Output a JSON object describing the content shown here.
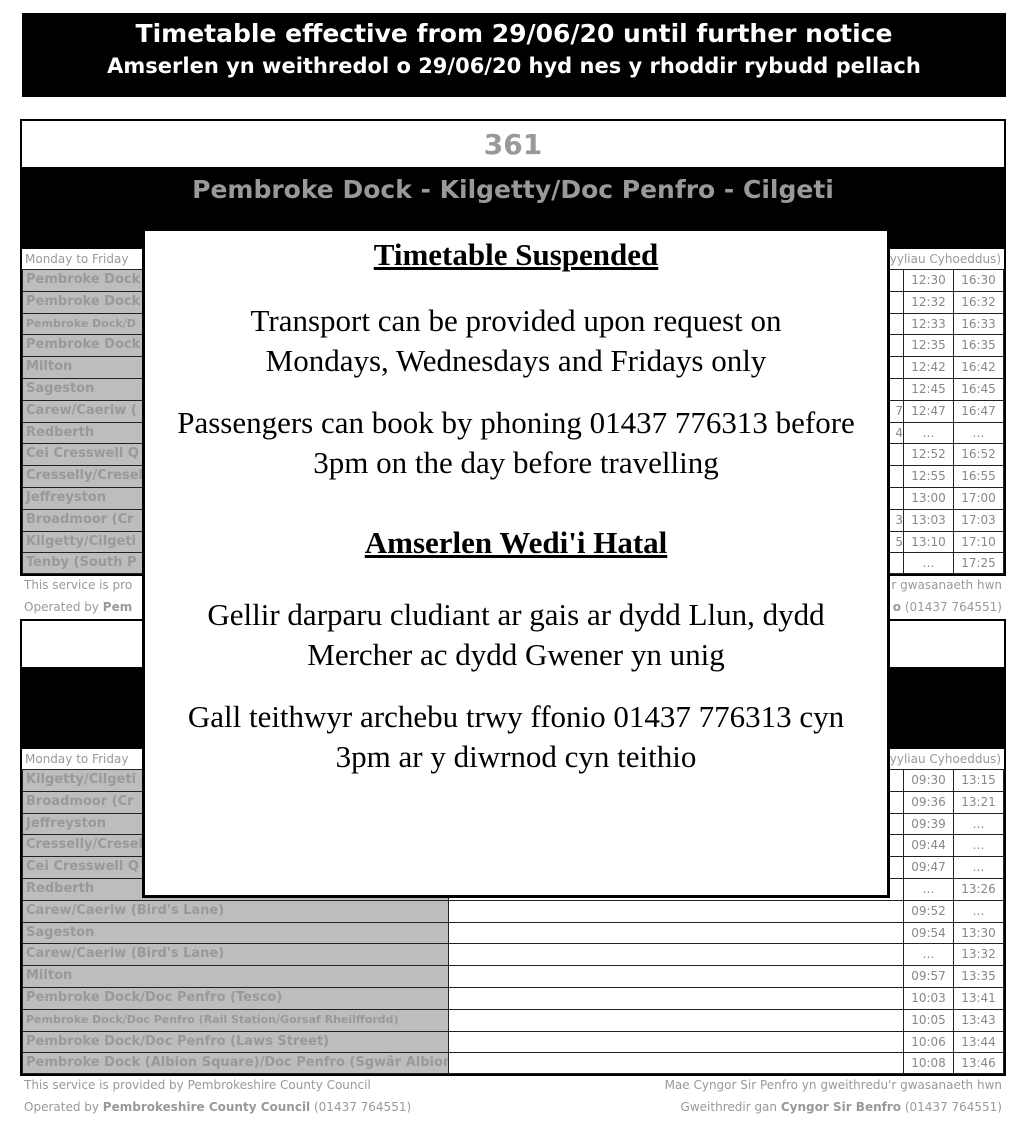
{
  "banner": {
    "line1": "Timetable effective from 29/06/20 until further notice",
    "line2": "Amserlen yn weithredol o 29/06/20 hyd nes y rhoddir rybudd pellach"
  },
  "tables": [
    {
      "number": "361",
      "route": "Pembroke Dock - Kilgetty/Doc Penfro - Cilgeti",
      "days_left": "Monday to Friday",
      "days_right": "yyliau Cyhoeddus)",
      "rows": [
        {
          "stop": "Pembroke Dock",
          "t1": "12:30",
          "t2": "16:30"
        },
        {
          "stop": "Pembroke Dock",
          "t1": "12:32",
          "t2": "16:32"
        },
        {
          "stop": "Pembroke Dock/D",
          "t1": "12:33",
          "t2": "16:33",
          "small": true
        },
        {
          "stop": "Pembroke Dock",
          "t1": "12:35",
          "t2": "16:35"
        },
        {
          "stop": "Milton",
          "t1": "12:42",
          "t2": "16:42"
        },
        {
          "stop": "Sageston",
          "t1": "12:45",
          "t2": "16:45"
        },
        {
          "stop": "Carew/Caeriw (",
          "t0": "7",
          "t1": "12:47",
          "t2": "16:47"
        },
        {
          "stop": "Redberth",
          "t0": "4",
          "t1": "…",
          "t2": "…"
        },
        {
          "stop": "Cei Cresswell Q",
          "t1": "12:52",
          "t2": "16:52"
        },
        {
          "stop": "Cresselly/Cresel",
          "t1": "12:55",
          "t2": "16:55"
        },
        {
          "stop": "Jeffreyston",
          "t1": "13:00",
          "t2": "17:00"
        },
        {
          "stop": "Broadmoor (Cr",
          "t0": "3",
          "t1": "13:03",
          "t2": "17:03"
        },
        {
          "stop": "Kilgetty/Cilgeti (",
          "t0": "5",
          "t1": "13:10",
          "t2": "17:10"
        },
        {
          "stop": "Tenby (South P",
          "t1": "…",
          "t2": "17:25"
        }
      ],
      "footer_left_1": "This service is pro",
      "footer_left_2_pre": "Operated by ",
      "footer_left_2_bold": "Pem",
      "footer_right_1": "r gwasanaeth hwn",
      "footer_right_2_bold": "o",
      "footer_right_2_post": " (01437 764551)"
    },
    {
      "number": "",
      "route": "",
      "days_left": "Monday to Friday",
      "days_right": "yyliau Cyhoeddus)",
      "rows": [
        {
          "stop": "Kilgetty/Cilgeti (",
          "t1": "09:30",
          "t2": "13:15"
        },
        {
          "stop": "Broadmoor (Cr",
          "t1": "09:36",
          "t2": "13:21"
        },
        {
          "stop": "Jeffreyston",
          "t1": "09:39",
          "t2": "…"
        },
        {
          "stop": "Cresselly/Cresel",
          "t1": "09:44",
          "t2": "…"
        },
        {
          "stop": "Cei Cresswell Q",
          "t1": "09:47",
          "t2": "…"
        },
        {
          "stop": "Redberth",
          "t1": "…",
          "t2": "13:26"
        },
        {
          "stop": "Carew/Caeriw (Bird's Lane)",
          "t1": "09:52",
          "t2": "…"
        },
        {
          "stop": "Sageston",
          "t1": "09:54",
          "t2": "13:30"
        },
        {
          "stop": "Carew/Caeriw (Bird's Lane)",
          "t1": "…",
          "t2": "13:32"
        },
        {
          "stop": "Milton",
          "t1": "09:57",
          "t2": "13:35"
        },
        {
          "stop": "Pembroke Dock/Doc Penfro (Tesco)",
          "t1": "10:03",
          "t2": "13:41"
        },
        {
          "stop": "Pembroke Dock/Doc Penfro (Rail Station/Gorsaf Rheilffordd)",
          "t1": "10:05",
          "t2": "13:43",
          "small": true
        },
        {
          "stop": "Pembroke Dock/Doc Penfro (Laws Street)",
          "t1": "10:06",
          "t2": "13:44"
        },
        {
          "stop": "Pembroke Dock (Albion Square)/Doc Penfro (Sgwâr Albion)",
          "t1": "10:08",
          "t2": "13:46"
        }
      ],
      "footer_left_1": "This service is provided by Pembrokeshire County Council",
      "footer_left_2_pre": "Operated by ",
      "footer_left_2_bold": "Pembrokeshire County Council",
      "footer_left_2_post": " (01437 764551)",
      "footer_right_1": "Mae Cyngor Sir Penfro yn gweithredu'r gwasanaeth hwn",
      "footer_right_2_pre": "Gweithredir gan ",
      "footer_right_2_bold": "Cyngor Sir Benfro",
      "footer_right_2_post": " (01437 764551)"
    }
  ],
  "notice": {
    "heading_en": "Timetable Suspended",
    "p1": "Transport can be provided upon request on Mondays, Wednesdays and Fridays only",
    "p2": "Passengers can book by phoning 01437 776313 before 3pm on the day before travelling",
    "heading_cy": "Amserlen Wedi'i Hatal",
    "p3": "Gellir darparu cludiant ar gais ar dydd Llun, dydd Mercher ac dydd Gwener yn unig",
    "p4": "Gall teithwyr archebu trwy ffonio 01437 776313 cyn 3pm ar y diwrnod cyn teithio"
  }
}
